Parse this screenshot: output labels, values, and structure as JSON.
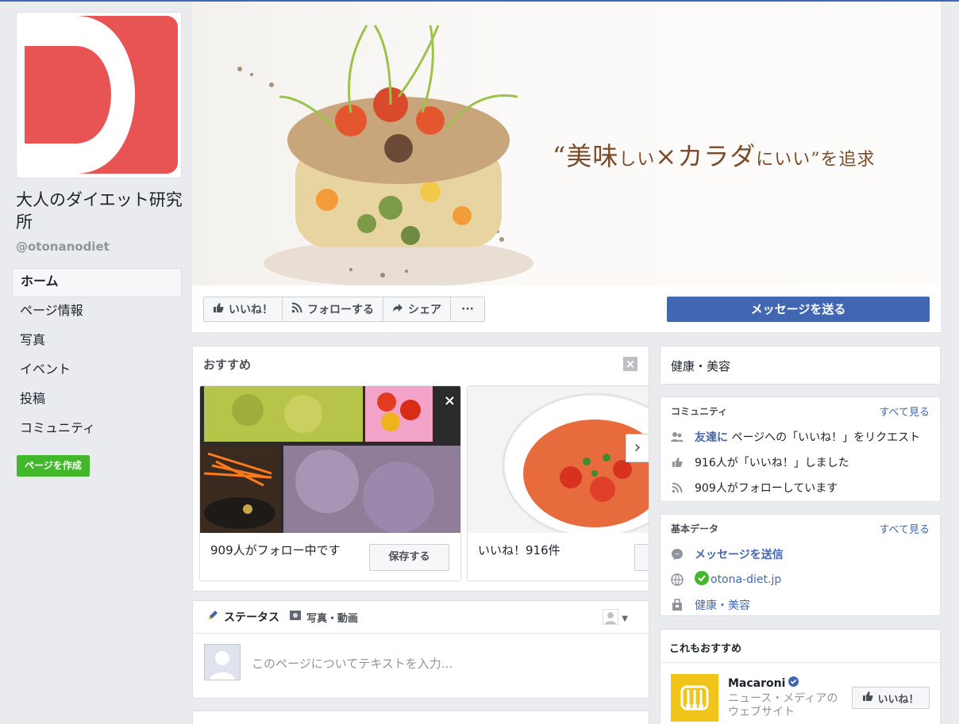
{
  "page": {
    "name": "大人のダイエット研究所",
    "handle": "@otonanodiet"
  },
  "sidebar": {
    "items": [
      {
        "label": "ホーム"
      },
      {
        "label": "ページ情報"
      },
      {
        "label": "写真"
      },
      {
        "label": "イベント"
      },
      {
        "label": "投稿"
      },
      {
        "label": "コミュニティ"
      }
    ],
    "create_page": "ページを作成"
  },
  "cover": {
    "tagline_a": "“美味",
    "tagline_b": "しい",
    "tagline_c": "×カラダ",
    "tagline_d": "にいい",
    "tagline_e": "”を追求"
  },
  "actions": {
    "like": "いいね！",
    "follow": "フォローする",
    "share": "シェア",
    "more": "···",
    "message": "メッセージを送る"
  },
  "recommend": {
    "title": "おすすめ",
    "items": [
      {
        "caption": "909人がフォロー中です",
        "button": "保存する"
      },
      {
        "caption": "いいね！916件"
      }
    ]
  },
  "composer": {
    "tab_status": "ステータス",
    "tab_photo": "写真・動画",
    "placeholder": "このページについてテキストを入力..."
  },
  "right": {
    "category": "健康・美容",
    "community": {
      "title": "コミュニティ",
      "see_all": "すべて見る",
      "rows": [
        {
          "link": "友達に",
          "text": "ページへの「いいね！」をリクエスト"
        },
        {
          "text": "916人が「いいね！」しました"
        },
        {
          "text": "909人がフォローしています"
        }
      ]
    },
    "basic": {
      "title": "基本データ",
      "see_all": "すべて見る",
      "message": "メッセージを送信",
      "website": "otona-diet.jp",
      "category": "健康・美容"
    },
    "also": {
      "title": "これもおすすめ",
      "name": "Macaroni",
      "desc": "ニュース・メディアのウェブサイト",
      "like": "いいね！"
    }
  },
  "colors": {
    "brand_red": "#e85454",
    "facebook_blue": "#4267b2",
    "green": "#42b72a"
  }
}
